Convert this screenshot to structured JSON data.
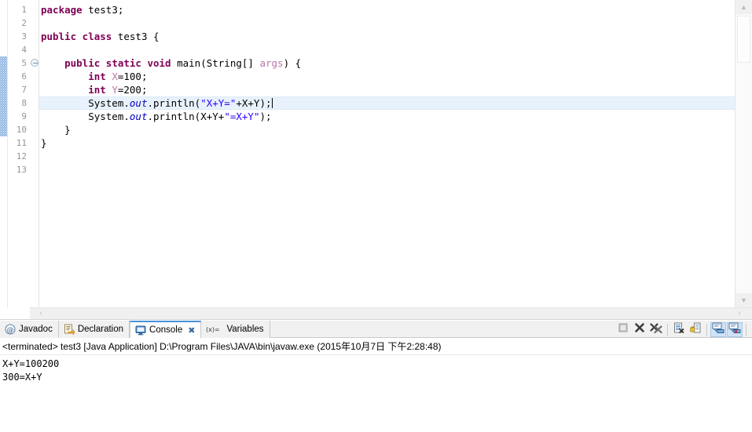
{
  "editor": {
    "name": "java-source-editor",
    "first_line": 1,
    "last_line": 13,
    "current_line": 8,
    "change_bar_lines": [
      5,
      6,
      7,
      8,
      9,
      10
    ],
    "fold_marker_line": 5,
    "caret_line": 8,
    "line_numbers": [
      "1",
      "2",
      "3",
      "4",
      "5",
      "6",
      "7",
      "8",
      "9",
      "10",
      "11",
      "12",
      "13"
    ],
    "colors": {
      "keyword": "#7f0055",
      "string": "#2a00ff",
      "field": "#0000c0",
      "parameter": "#bb77a8",
      "current_line_highlight": "#e8f2fc",
      "gutter_text": "#969696",
      "change_bar": "#8fb5e0"
    },
    "lines": [
      {
        "n": "1",
        "tokens": [
          {
            "t": "kw",
            "s": "package"
          },
          {
            "t": "plain",
            "s": " test3;"
          }
        ]
      },
      {
        "n": "2",
        "tokens": [
          {
            "t": "plain",
            "s": ""
          }
        ]
      },
      {
        "n": "3",
        "tokens": [
          {
            "t": "kw",
            "s": "public class"
          },
          {
            "t": "plain",
            "s": " test3 {"
          }
        ]
      },
      {
        "n": "4",
        "tokens": [
          {
            "t": "plain",
            "s": ""
          }
        ]
      },
      {
        "n": "5",
        "tokens": [
          {
            "t": "plain",
            "s": "    "
          },
          {
            "t": "kw",
            "s": "public static void"
          },
          {
            "t": "plain",
            "s": " main(String[] "
          },
          {
            "t": "param",
            "s": "args"
          },
          {
            "t": "plain",
            "s": ") {"
          }
        ]
      },
      {
        "n": "6",
        "tokens": [
          {
            "t": "plain",
            "s": "        "
          },
          {
            "t": "kw",
            "s": "int"
          },
          {
            "t": "plain",
            "s": " "
          },
          {
            "t": "param",
            "s": "X"
          },
          {
            "t": "plain",
            "s": "=100;"
          }
        ]
      },
      {
        "n": "7",
        "tokens": [
          {
            "t": "plain",
            "s": "        "
          },
          {
            "t": "kw",
            "s": "int"
          },
          {
            "t": "plain",
            "s": " "
          },
          {
            "t": "param",
            "s": "Y"
          },
          {
            "t": "plain",
            "s": "=200;"
          }
        ]
      },
      {
        "n": "8",
        "tokens": [
          {
            "t": "plain",
            "s": "        System."
          },
          {
            "t": "field",
            "s": "out"
          },
          {
            "t": "plain",
            "s": ".println("
          },
          {
            "t": "str",
            "s": "\"X+Y=\""
          },
          {
            "t": "plain",
            "s": "+X+Y);"
          },
          {
            "t": "caret",
            "s": ""
          }
        ]
      },
      {
        "n": "9",
        "tokens": [
          {
            "t": "plain",
            "s": "        System."
          },
          {
            "t": "field",
            "s": "out"
          },
          {
            "t": "plain",
            "s": ".println(X+Y+"
          },
          {
            "t": "str",
            "s": "\"=X+Y\""
          },
          {
            "t": "plain",
            "s": ");"
          }
        ]
      },
      {
        "n": "10",
        "tokens": [
          {
            "t": "plain",
            "s": "    }"
          }
        ]
      },
      {
        "n": "11",
        "tokens": [
          {
            "t": "plain",
            "s": "}"
          }
        ]
      },
      {
        "n": "12",
        "tokens": [
          {
            "t": "plain",
            "s": ""
          }
        ]
      },
      {
        "n": "13",
        "tokens": [
          {
            "t": "plain",
            "s": ""
          }
        ]
      }
    ],
    "vscroll": {
      "up_arrow": "▲",
      "down_arrow": "▼"
    },
    "hscroll": {
      "left_arrow": "‹",
      "right_arrow": "›"
    }
  },
  "bottom_panel": {
    "tabs": [
      {
        "label": "Javadoc",
        "icon": "at-sign-icon",
        "active": false,
        "closeable": false
      },
      {
        "label": "Declaration",
        "icon": "declaration-icon",
        "active": false,
        "closeable": false
      },
      {
        "label": "Console",
        "icon": "console-icon",
        "active": true,
        "closeable": true,
        "close_glyph": "✖"
      },
      {
        "label": "Variables",
        "icon": "variables-icon",
        "active": false,
        "closeable": false
      }
    ],
    "toolbar": [
      {
        "name": "terminate-button",
        "icon": "stop-square-icon",
        "pressed": false
      },
      {
        "name": "remove-launch-button",
        "icon": "remove-x-icon",
        "pressed": false
      },
      {
        "name": "remove-all-terminated-button",
        "icon": "remove-all-x-icon",
        "pressed": false
      },
      {
        "name": "clear-console-button",
        "icon": "clear-console-icon",
        "pressed": false
      },
      {
        "name": "scroll-lock-button",
        "icon": "scroll-lock-icon",
        "pressed": false
      },
      {
        "name": "pin-console-button",
        "icon": "pin-console-icon",
        "pressed": true
      },
      {
        "name": "display-selected-console-button",
        "icon": "display-console-icon",
        "pressed": true
      }
    ],
    "console": {
      "header": "<terminated> test3 [Java Application] D:\\Program Files\\JAVA\\bin\\javaw.exe (2015年10月7日 下午2:28:48)",
      "output_lines": [
        "X+Y=100200",
        "300=X+Y"
      ]
    }
  }
}
